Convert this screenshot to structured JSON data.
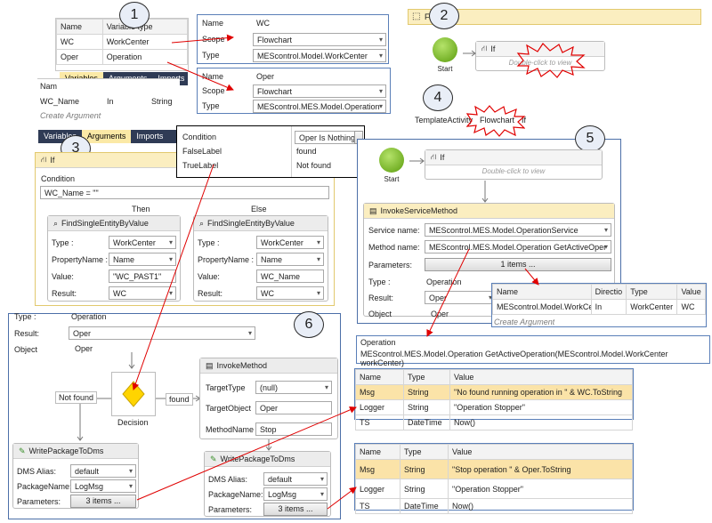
{
  "callouts": [
    "1",
    "2",
    "3",
    "4",
    "5",
    "6"
  ],
  "variables_table": {
    "headers": [
      "Name",
      "Variable type"
    ],
    "rows": [
      [
        "WC",
        "WorkCenter"
      ],
      [
        "Oper",
        "Operation"
      ]
    ]
  },
  "wc_props": {
    "rows": [
      {
        "label": "Name",
        "value": "WC",
        "kind": "text"
      },
      {
        "label": "Scope",
        "value": "Flowchart",
        "kind": "combo"
      },
      {
        "label": "Type",
        "value": "MEScontrol.Model.WorkCenter",
        "kind": "combo"
      }
    ]
  },
  "oper_props": {
    "rows": [
      {
        "label": "Name",
        "value": "Oper",
        "kind": "text"
      },
      {
        "label": "Scope",
        "value": "Flowchart",
        "kind": "combo"
      },
      {
        "label": "Type",
        "value": "MEScontrol.MES.Model.Operation",
        "kind": "combo"
      }
    ]
  },
  "tabs_1": [
    "Variables",
    "Arguments",
    "Imports"
  ],
  "arguments_table": {
    "header_partial": "Nam",
    "row": [
      "WC_Name",
      "In",
      "String"
    ],
    "create": "Create Argument"
  },
  "tabs_3": [
    "Variables",
    "Arguments",
    "Imports"
  ],
  "flowchart_header": "Fl",
  "start_label": "Start",
  "if_label": "If",
  "double_click": "Double-click to view",
  "breadcrumb": [
    "TemplateActivity",
    "Flowchart",
    "If"
  ],
  "condition_props": {
    "rows": [
      [
        "Condition",
        "Oper Is Nothing"
      ],
      [
        "FalseLabel",
        "found"
      ],
      [
        "TrueLabel",
        "Not found"
      ]
    ]
  },
  "if_activity": {
    "title": "If",
    "condition_label": "Condition",
    "condition_value": "WC_Name = \"\"",
    "then": "Then",
    "else": "Else",
    "left": {
      "title": "FindSingleEntityByValue",
      "rows": [
        {
          "label": "Type :",
          "value": "WorkCenter",
          "kind": "combo"
        },
        {
          "label": "PropertyName :",
          "value": "Name",
          "kind": "combo"
        },
        {
          "label": "Value:",
          "value": "\"WC_PAST1\"",
          "kind": "text"
        },
        {
          "label": "Result:",
          "value": "WC",
          "kind": "combo"
        }
      ]
    },
    "right": {
      "title": "FindSingleEntityByValue",
      "rows": [
        {
          "label": "Type :",
          "value": "WorkCenter",
          "kind": "combo"
        },
        {
          "label": "PropertyName :",
          "value": "Name",
          "kind": "combo"
        },
        {
          "label": "Value:",
          "value": "WC_Name",
          "kind": "text"
        },
        {
          "label": "Result:",
          "value": "WC",
          "kind": "combo"
        }
      ]
    }
  },
  "invoke_service": {
    "title": "InvokeServiceMethod",
    "service_label": "Service name:",
    "service_value": "MEScontrol.MES.Model.OperationService",
    "method_label": "Method name:",
    "method_value": "MEScontrol.MES.Model.Operation GetActiveOper",
    "params_label": "Parameters:",
    "params_button": "1 items ...",
    "type_label": "Type :",
    "type_value": "Operation",
    "result_label": "Result:",
    "result_value": "Oper",
    "object_label": "Object",
    "object_value": "Oper"
  },
  "param_table_5": {
    "headers": [
      "Name",
      "Directio",
      "Type",
      "Value"
    ],
    "row": [
      "MEScontrol.Model.WorkCente",
      "In",
      "WorkCenter",
      "WC"
    ],
    "create": "Create Argument"
  },
  "operation_box": {
    "title": "Operation",
    "signature": "MEScontrol.MES.Model.Operation GetActiveOperation(MEScontrol.Model.WorkCenter workCenter)",
    "cut": "Get Active Operation"
  },
  "flow6": {
    "type_label": "Type :",
    "type_value": "Operation",
    "result_label": "Result:",
    "result_value": "Oper",
    "object_label": "Object",
    "object_value": "Oper",
    "decision_label": "Decision",
    "found_label": "found",
    "not_found_label": "Not found",
    "invoke": {
      "title": "InvokeMethod",
      "rows": [
        {
          "label": "TargetType",
          "value": "(null)",
          "kind": "combo"
        },
        {
          "label": "TargetObject",
          "value": "Oper",
          "kind": "text"
        },
        {
          "label": "MethodName",
          "value": "Stop",
          "kind": "text"
        }
      ]
    },
    "write_left": {
      "title": "WritePackageToDms",
      "rows": [
        {
          "label": "DMS Alias:",
          "value": "default",
          "kind": "combo"
        },
        {
          "label": "PackageName:",
          "value": "LogMsg",
          "kind": "combo"
        }
      ],
      "params_label": "Parameters:",
      "params_button": "3 items ..."
    },
    "write_right": {
      "title": "WritePackageToDms",
      "rows": [
        {
          "label": "DMS Alias:",
          "value": "default",
          "kind": "combo"
        },
        {
          "label": "PackageName:",
          "value": "LogMsg",
          "kind": "combo"
        }
      ],
      "params_label": "Parameters:",
      "params_button": "3 items ..."
    }
  },
  "msg_table_1": {
    "headers": [
      "Name",
      "Type",
      "Value"
    ],
    "rows": [
      [
        "Msg",
        "String",
        "\"No found running operation in \" & WC.ToString"
      ],
      [
        "Logger",
        "String",
        "\"Operation Stopper\""
      ],
      [
        "TS",
        "DateTime",
        "Now()"
      ]
    ]
  },
  "msg_table_2": {
    "headers": [
      "Name",
      "Type",
      "Value"
    ],
    "rows": [
      [
        "Msg",
        "String",
        "\"Stop operation \" & Oper.ToString"
      ],
      [
        "Logger",
        "String",
        "\"Operation Stopper\""
      ],
      [
        "TS",
        "DateTime",
        "Now()"
      ]
    ]
  },
  "colors": {
    "arrow": "#e00000",
    "tab_bar": "#2f3b55",
    "tab_active": "#fbe9a6",
    "highlight_row": "#fbe3a8",
    "panel_border": "#5a7fb8",
    "start_green": "#5a9c0c",
    "decision_yellow": "#ffd400"
  }
}
